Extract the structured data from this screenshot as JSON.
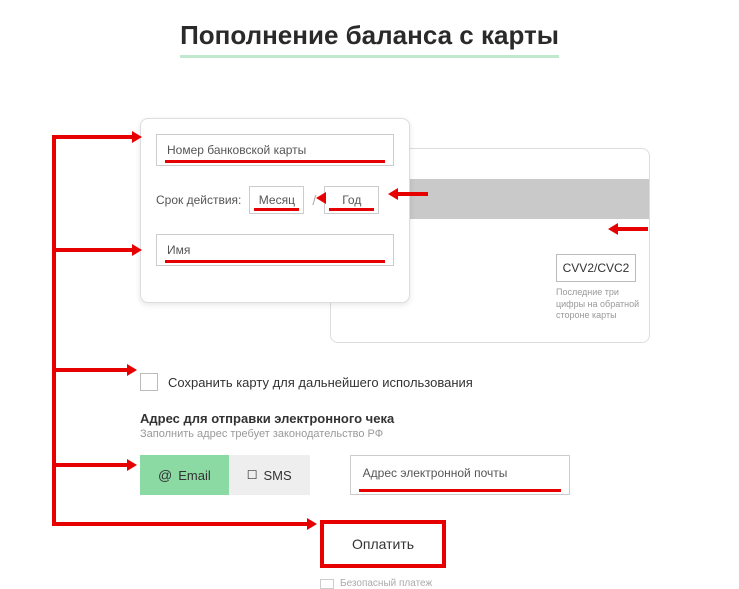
{
  "title": "Пополнение баланса с карты",
  "card": {
    "number_placeholder": "Номер банковской карты",
    "expiry_label": "Срок действия:",
    "month_placeholder": "Месяц",
    "year_placeholder": "Год",
    "name_placeholder": "Имя",
    "cvv_placeholder": "CVV2/CVC2",
    "cvv_hint": "Последние три цифры на обратной стороне карты"
  },
  "save": {
    "label": "Сохранить карту для дальнейшего использования"
  },
  "receipt": {
    "title": "Адрес для отправки электронного чека",
    "hint": "Заполнить адрес требует законодательство РФ",
    "email_label": "Email",
    "sms_label": "SMS",
    "email_placeholder": "Адрес электронной почты"
  },
  "pay": {
    "label": "Оплатить",
    "secure_label": "Безопасный платеж"
  },
  "icons": {
    "at": "@",
    "sms": "💬"
  }
}
